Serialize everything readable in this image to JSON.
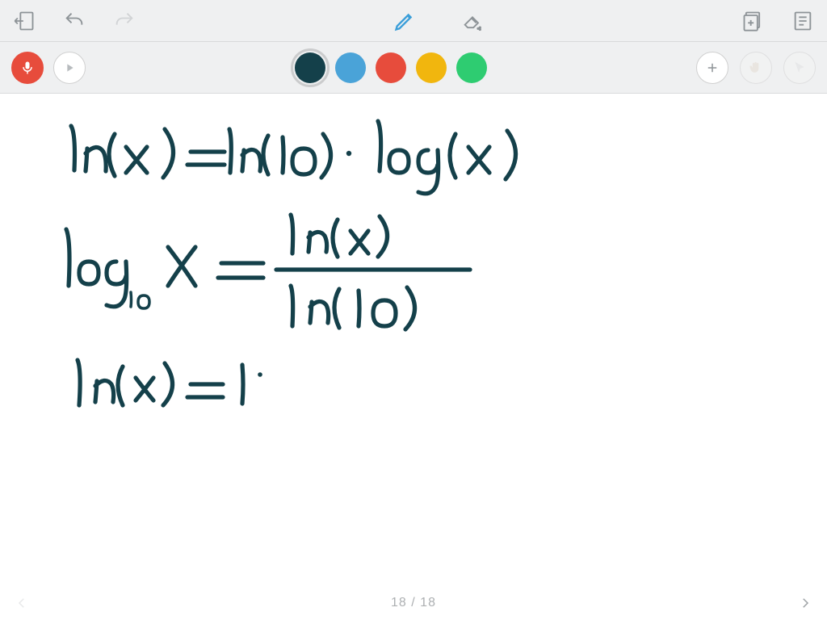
{
  "colors": {
    "darkteal": "#14404a",
    "blue": "#4aa3d8",
    "red": "#e74c3c",
    "amber": "#f1b60e",
    "green": "#2ecc71",
    "toolbar_icon": "#8d9397",
    "pen_active": "#3a9ed9"
  },
  "page": {
    "current": 18,
    "total": 18,
    "display": "18 / 18"
  },
  "handwriting": {
    "line1": "ln(x) = ln(10) · log(x)",
    "line2": "log₁₀ x = ln(x) / ln(10)",
    "line3": "ln(x) = 1·"
  },
  "icons": {
    "exit": "exit",
    "undo": "undo",
    "redo": "redo",
    "pen": "pen",
    "eraser": "eraser",
    "pages": "pages",
    "notes": "notes",
    "mic": "mic",
    "play": "play",
    "plus": "+",
    "hand": "hand",
    "cursor": "cursor",
    "prev": "‹",
    "next": "›"
  }
}
